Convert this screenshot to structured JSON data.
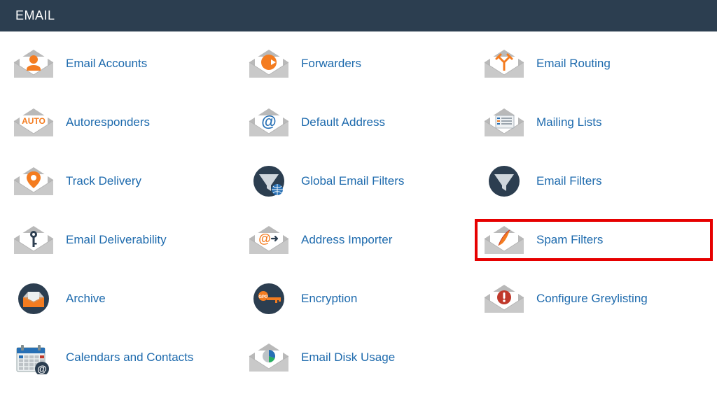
{
  "header": {
    "title": "EMAIL"
  },
  "items": [
    {
      "key": "email-accounts",
      "label": "Email Accounts",
      "icon": "envelope-person"
    },
    {
      "key": "forwarders",
      "label": "Forwarders",
      "icon": "envelope-arrow"
    },
    {
      "key": "email-routing",
      "label": "Email Routing",
      "icon": "envelope-split"
    },
    {
      "key": "autoresponders",
      "label": "Autoresponders",
      "icon": "envelope-auto"
    },
    {
      "key": "default-address",
      "label": "Default Address",
      "icon": "envelope-at"
    },
    {
      "key": "mailing-lists",
      "label": "Mailing Lists",
      "icon": "envelope-list"
    },
    {
      "key": "track-delivery",
      "label": "Track Delivery",
      "icon": "envelope-pin"
    },
    {
      "key": "global-email-filters",
      "label": "Global Email Filters",
      "icon": "funnel-globe"
    },
    {
      "key": "email-filters",
      "label": "Email Filters",
      "icon": "funnel"
    },
    {
      "key": "email-deliverability",
      "label": "Email Deliverability",
      "icon": "envelope-key"
    },
    {
      "key": "address-importer",
      "label": "Address Importer",
      "icon": "envelope-import"
    },
    {
      "key": "spam-filters",
      "label": "Spam Filters",
      "icon": "envelope-feather",
      "highlighted": true
    },
    {
      "key": "archive",
      "label": "Archive",
      "icon": "archive-box"
    },
    {
      "key": "encryption",
      "label": "Encryption",
      "icon": "gpg-key"
    },
    {
      "key": "configure-greylisting",
      "label": "Configure Greylisting",
      "icon": "envelope-alert"
    },
    {
      "key": "calendars-and-contacts",
      "label": "Calendars and Contacts",
      "icon": "calendar-at"
    },
    {
      "key": "email-disk-usage",
      "label": "Email Disk Usage",
      "icon": "envelope-pie"
    }
  ],
  "colors": {
    "link": "#1d6aad",
    "header_bg": "#2c3e50"
  }
}
